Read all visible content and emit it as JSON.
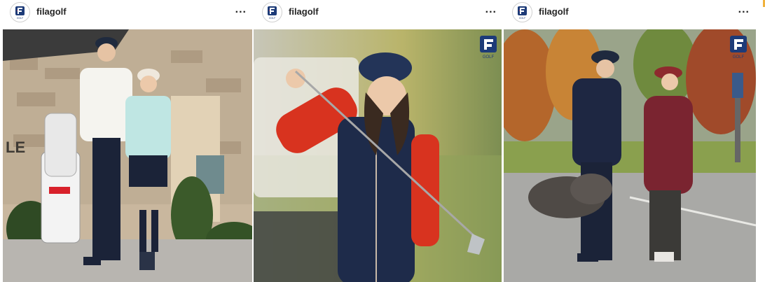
{
  "posts": [
    {
      "username": "filagolf",
      "more": "...",
      "accent": "#1d3b78"
    },
    {
      "username": "filagolf",
      "more": "...",
      "accent": "#1d3b78"
    },
    {
      "username": "filagolf",
      "more": "...",
      "accent": "#1d3b78"
    }
  ],
  "brand": {
    "logo_letter": "F",
    "logo_caption": "GOLF",
    "navy": "#1d3b78",
    "red": "#d8202a"
  },
  "photo1": {
    "wall_sign": "LE"
  },
  "icons": {
    "avatar": "fila-golf-logo-icon",
    "more": "more-options-icon"
  }
}
